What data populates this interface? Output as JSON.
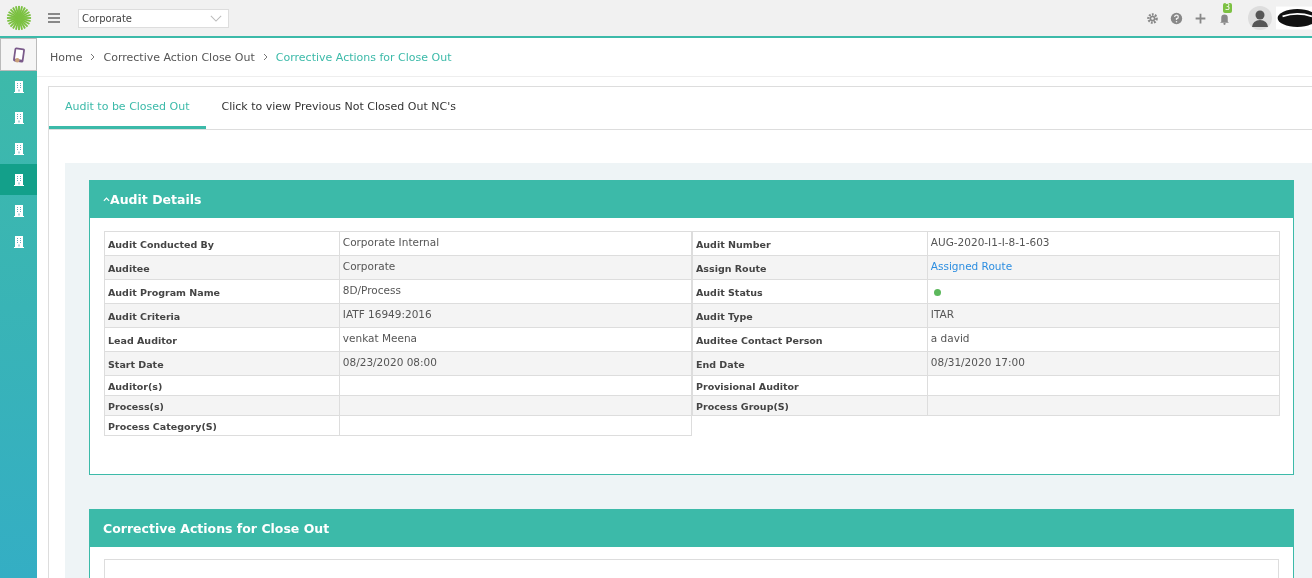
{
  "topbar": {
    "org_select": {
      "value": "Corporate"
    },
    "notification_count": "3"
  },
  "sidebar": {
    "items": [
      {
        "selected": false
      },
      {
        "selected": false
      },
      {
        "selected": false
      },
      {
        "selected": true
      },
      {
        "selected": false
      },
      {
        "selected": false
      }
    ]
  },
  "breadcrumb": [
    "Home",
    "Corrective Action Close Out",
    "Corrective Actions for Close Out"
  ],
  "tabs": [
    {
      "label": "Audit to be Closed Out",
      "selected": true
    },
    {
      "label": "Click to view Previous Not Closed Out NC's",
      "selected": false
    }
  ],
  "audit_details": {
    "title": "Audit Details",
    "expanded": true,
    "left": [
      {
        "label": "Audit Conducted By",
        "kind": "text",
        "value": "Corporate Internal"
      },
      {
        "label": "Auditee",
        "kind": "text",
        "value": "Corporate"
      },
      {
        "label": "Audit Program Name",
        "kind": "text",
        "value": "8D/Process"
      },
      {
        "label": "Audit Criteria",
        "kind": "text",
        "value": "IATF 16949:2016"
      },
      {
        "label": "Lead Auditor",
        "kind": "text",
        "value": "venkat Meena"
      },
      {
        "label": "Start Date",
        "kind": "text",
        "value": "08/23/2020 08:00"
      },
      {
        "label": "Auditor(s)",
        "kind": "empty"
      },
      {
        "label": "Process(s)",
        "kind": "empty"
      },
      {
        "label": "Process Category(S)",
        "kind": "empty"
      }
    ],
    "right": [
      {
        "label": "Audit Number",
        "kind": "text",
        "value": "AUG-2020-I1-I-8-1-603"
      },
      {
        "label": "Assign Route",
        "kind": "link",
        "value": "Assigned Route"
      },
      {
        "label": "Audit Status",
        "kind": "status",
        "color": "#5cb85c"
      },
      {
        "label": "Audit Type",
        "kind": "text",
        "value": "ITAR"
      },
      {
        "label": "Auditee Contact Person",
        "kind": "text",
        "value": "a david"
      },
      {
        "label": "End Date",
        "kind": "text",
        "value": "08/31/2020 17:00"
      },
      {
        "label": "Provisional Auditor",
        "kind": "empty"
      },
      {
        "label": "Process Group(S)",
        "kind": "empty"
      }
    ]
  },
  "corrective_actions": {
    "title": "Corrective Actions for Close Out"
  }
}
